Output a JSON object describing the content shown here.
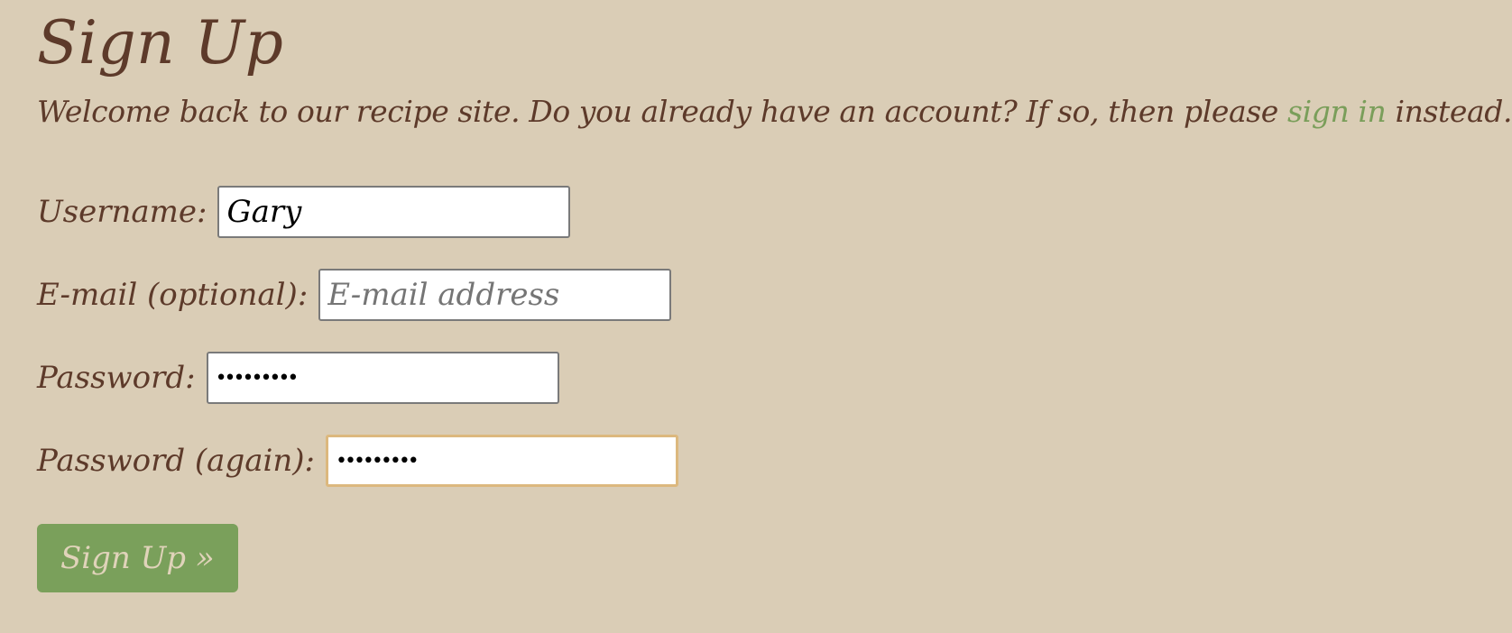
{
  "page": {
    "title": "Sign Up",
    "intro_before": "Welcome back to our recipe site. Do you already have an account? If so, then please ",
    "signin_link": "sign in",
    "intro_after": " instead."
  },
  "form": {
    "username": {
      "label": "Username:",
      "value": "Gary",
      "placeholder": ""
    },
    "email": {
      "label": "E-mail (optional):",
      "value": "",
      "placeholder": "E-mail address"
    },
    "password": {
      "label": "Password:",
      "value": "•••••••••"
    },
    "password_again": {
      "label": "Password (again):",
      "value": "•••••••••"
    },
    "submit_label": "Sign Up »"
  },
  "colors": {
    "background": "#dacdb6",
    "text": "#5d3a2a",
    "link": "#7a9e5a",
    "button": "#7aa05b",
    "button_text": "#e0d3ba",
    "focus_border": "#dcb87e"
  }
}
